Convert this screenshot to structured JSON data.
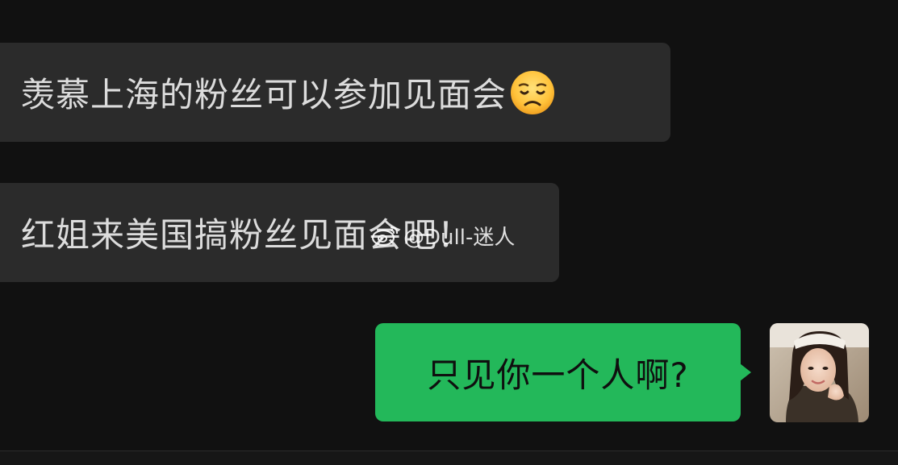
{
  "messages": [
    {
      "direction": "incoming",
      "text": "羡慕上海的粉丝可以参加见面会",
      "emoji": "disappointed-face-emoji"
    },
    {
      "direction": "incoming",
      "text": "红姐来美国搞粉丝见面会吧！"
    },
    {
      "direction": "outgoing",
      "text": "只见你一个人啊?"
    }
  ],
  "watermark": {
    "text": "@Dull-迷人",
    "icon": "weibo-icon"
  },
  "colors": {
    "background": "#111111",
    "incoming_bubble": "#2b2b2b",
    "outgoing_bubble": "#23b85a",
    "incoming_text": "#dcdcdc",
    "outgoing_text": "#0f0f0f"
  }
}
